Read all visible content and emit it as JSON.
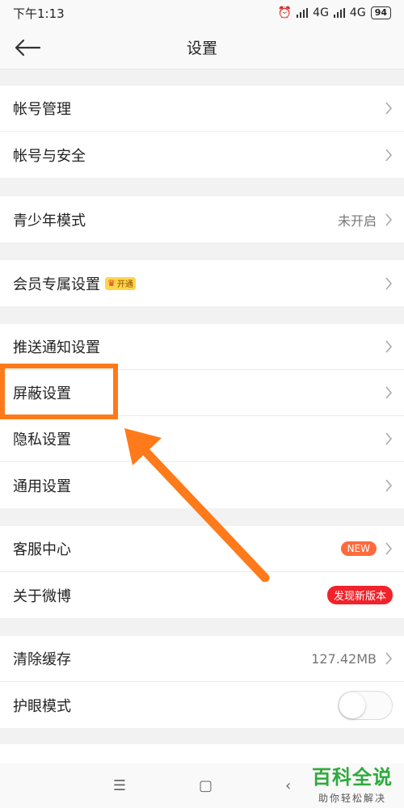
{
  "status_bar": {
    "time": "下午1:13",
    "network1": "4G",
    "network2": "4G",
    "battery": "94"
  },
  "header": {
    "title": "设置"
  },
  "groups": [
    {
      "items": [
        {
          "label": "帐号管理"
        },
        {
          "label": "帐号与安全"
        }
      ]
    },
    {
      "items": [
        {
          "label": "青少年模式",
          "value": "未开启"
        }
      ]
    },
    {
      "items": [
        {
          "label": "会员专属设置",
          "badge": "开通"
        }
      ]
    },
    {
      "items": [
        {
          "label": "推送通知设置"
        },
        {
          "label": "屏蔽设置"
        },
        {
          "label": "隐私设置"
        },
        {
          "label": "通用设置"
        }
      ]
    },
    {
      "items": [
        {
          "label": "客服中心",
          "badge": "NEW"
        },
        {
          "label": "关于微博",
          "badge": "发现新版本"
        }
      ]
    },
    {
      "items": [
        {
          "label": "清除缓存",
          "value": "127.42MB"
        },
        {
          "label": "护眼模式",
          "toggle": false
        }
      ]
    }
  ],
  "watermark": {
    "title": "百科全说",
    "subtitle": "助你轻松解决"
  },
  "colors": {
    "highlight": "#ff7a1a",
    "new_badge": "#ff6a3d",
    "update_badge": "#f1222a",
    "watermark": "#2eaa3c"
  }
}
